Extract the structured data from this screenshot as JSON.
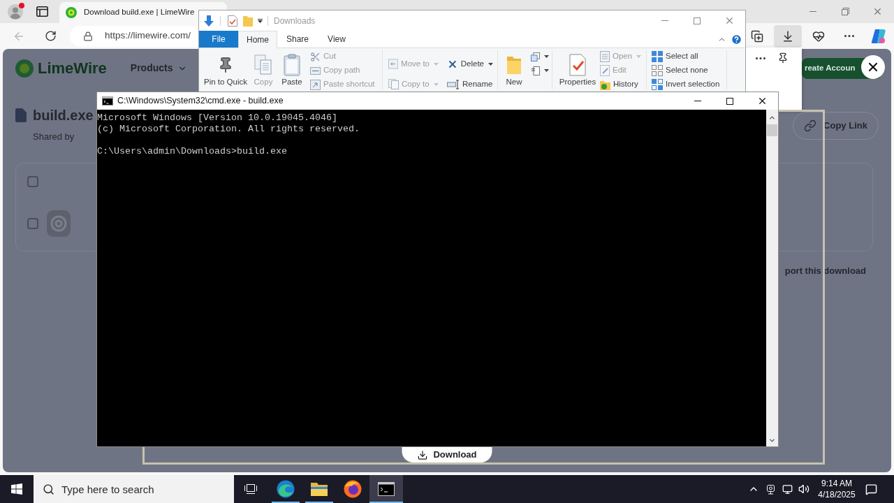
{
  "browser": {
    "profile": {
      "notification": true
    },
    "tabs": [
      {
        "title": "Download build.exe | LimeWire",
        "selected": true
      }
    ],
    "address": {
      "value": "https://limewire.com/"
    },
    "toolbar": {
      "downloads_active": true
    }
  },
  "page": {
    "logo": "LimeWire",
    "nav": [
      {
        "label": "Products"
      }
    ],
    "account_button": "reate Accoun",
    "file": {
      "title": "build.exe",
      "shared_by": "Shared by"
    },
    "copy_link": "Copy Link",
    "list": {
      "header_checked": false,
      "rows": [
        {
          "checked": false
        }
      ]
    },
    "report_link": "port this download",
    "download_button": "Download"
  },
  "explorer": {
    "title": "Downloads",
    "tabs": [
      {
        "label": "File",
        "kind": "menu",
        "selected": false
      },
      {
        "label": "Home",
        "kind": "tab",
        "selected": true
      },
      {
        "label": "Share",
        "kind": "tab",
        "selected": false
      },
      {
        "label": "View",
        "kind": "tab",
        "selected": false
      }
    ],
    "ribbon": {
      "clipboard": {
        "pin": {
          "label": "Pin to Quick",
          "disabled": false
        },
        "copy": {
          "label": "Copy",
          "disabled": true
        },
        "paste": {
          "label": "Paste",
          "disabled": false
        },
        "cut": {
          "label": "Cut",
          "disabled": true
        },
        "copy_path": {
          "label": "Copy path",
          "disabled": true
        },
        "paste_shortcut": {
          "label": "Paste shortcut",
          "disabled": true
        }
      },
      "organize": {
        "move_to": {
          "label": "Move to",
          "disabled": true,
          "dropdown": true
        },
        "copy_to": {
          "label": "Copy to",
          "disabled": true,
          "dropdown": true
        },
        "delete": {
          "label": "Delete",
          "disabled": false,
          "dropdown": true
        },
        "rename": {
          "label": "Rename",
          "disabled": false
        }
      },
      "new": {
        "new_folder": {
          "label": "New",
          "disabled": false
        },
        "new_item": {
          "dropdown": true
        },
        "easy_access": {
          "dropdown": true
        }
      },
      "open": {
        "properties": {
          "label": "Properties",
          "disabled": false
        },
        "open": {
          "label": "Open",
          "disabled": true,
          "dropdown": true
        },
        "edit": {
          "label": "Edit",
          "disabled": true
        },
        "history": {
          "label": "History",
          "disabled": false
        }
      },
      "select": {
        "select_all": {
          "label": "Select all",
          "disabled": false
        },
        "select_none": {
          "label": "Select none",
          "disabled": false
        },
        "invert_selection": {
          "label": "Invert selection",
          "disabled": false
        }
      }
    }
  },
  "console": {
    "title": "C:\\Windows\\System32\\cmd.exe - build.exe",
    "blocks": [
      {
        "lines": [
          "Microsoft Windows [Version 10.0.19045.4046]",
          "(c) Microsoft Corporation. All rights reserved."
        ]
      },
      {
        "lines": [
          "C:\\Users\\admin\\Downloads>build.exe"
        ]
      }
    ]
  },
  "taskbar": {
    "search": {
      "placeholder": "Type here to search"
    },
    "apps": [
      {
        "kind": "edge",
        "running": true,
        "selected": false
      },
      {
        "kind": "explorer",
        "running": true,
        "selected": false
      },
      {
        "kind": "firefox",
        "running": false,
        "selected": false
      },
      {
        "kind": "terminal",
        "running": true,
        "selected": true
      }
    ],
    "clock": {
      "time": "9:14 AM",
      "date": "4/18/2025"
    }
  }
}
